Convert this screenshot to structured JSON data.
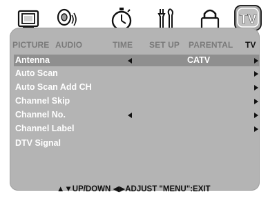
{
  "tabs": [
    {
      "label": "PICTURE",
      "icon": "picture-icon"
    },
    {
      "label": "AUDIO",
      "icon": "audio-icon"
    },
    {
      "label": "TIME",
      "icon": "stopwatch-icon"
    },
    {
      "label": "SET UP",
      "icon": "tools-icon"
    },
    {
      "label": "PARENTAL",
      "icon": "lock-icon"
    },
    {
      "label": "TV",
      "icon": "tv-icon",
      "active": true
    }
  ],
  "menu": [
    {
      "label": "Antenna",
      "value": "CATV",
      "left_arrow": true,
      "right_arrow": true
    },
    {
      "label": "Auto Scan",
      "value": "",
      "left_arrow": false,
      "right_arrow": true
    },
    {
      "label": "Auto Scan Add CH",
      "value": "",
      "left_arrow": false,
      "right_arrow": true
    },
    {
      "label": "Channel Skip",
      "value": "",
      "left_arrow": false,
      "right_arrow": true
    },
    {
      "label": "Channel No.",
      "value": "",
      "left_arrow": true,
      "right_arrow": true
    },
    {
      "label": "Channel Label",
      "value": "",
      "left_arrow": false,
      "right_arrow": true
    },
    {
      "label": "DTV Signal",
      "value": "",
      "left_arrow": false,
      "right_arrow": false
    }
  ],
  "footer": "▲▼UP/DOWN  ◀▶ADJUST  \"MENU\":EXIT",
  "colors": {
    "panel": "#b4b4b4",
    "menu_text": "#ffffff",
    "inactive_tab": "#7a7a7a",
    "active_tab": "#111111",
    "tv_icon_fill": "#a8a8a8"
  }
}
